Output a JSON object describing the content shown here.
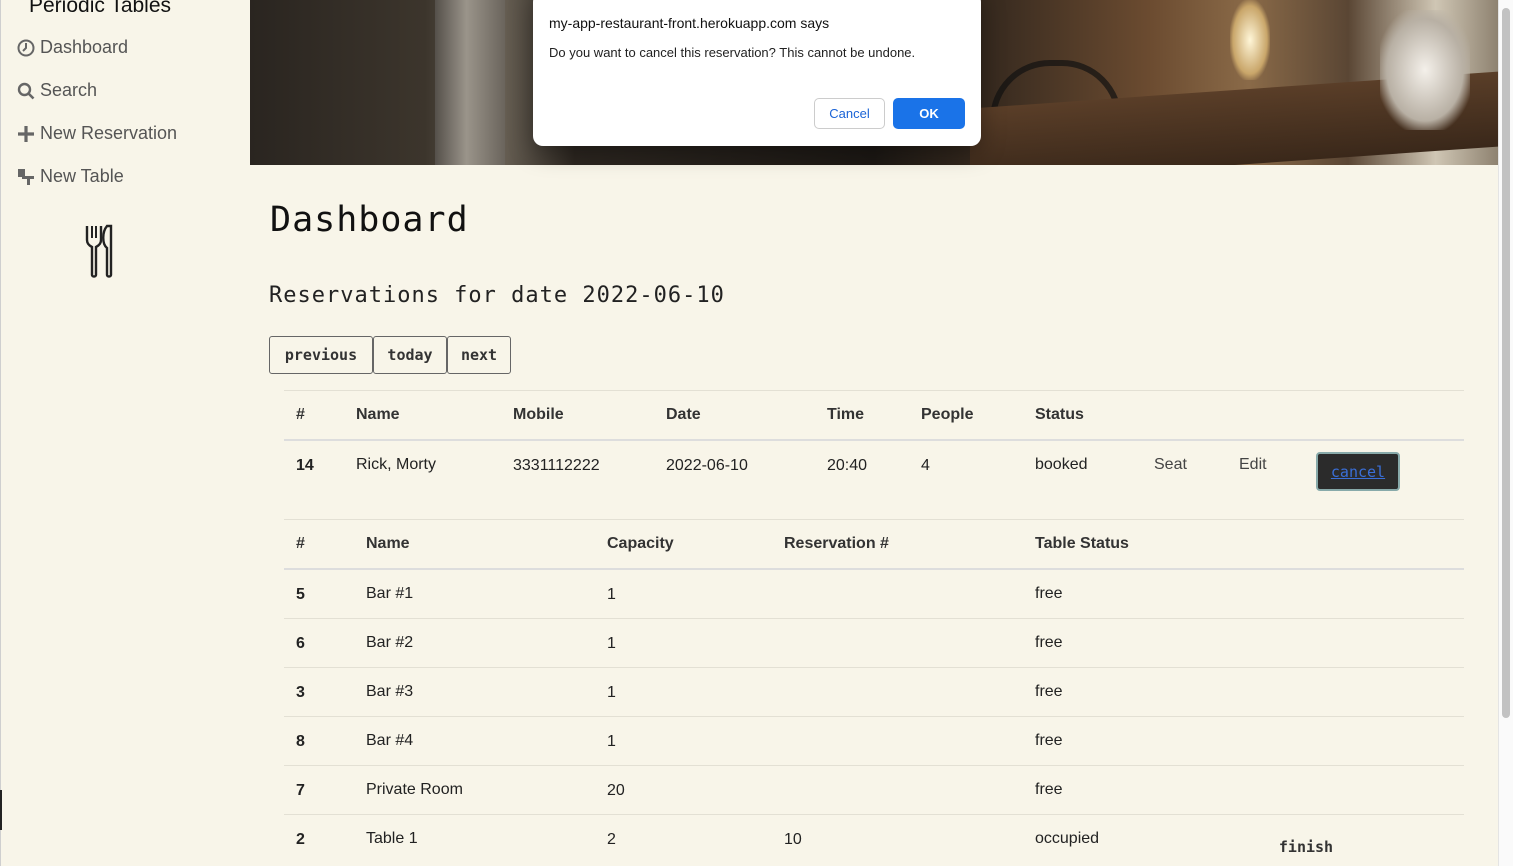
{
  "sidebar": {
    "brand": "Periodic Tables",
    "items": [
      {
        "label": "Dashboard",
        "icon": "dashboard-icon"
      },
      {
        "label": "Search",
        "icon": "search-icon"
      },
      {
        "label": "New Reservation",
        "icon": "plus-icon"
      },
      {
        "label": "New Table",
        "icon": "table-icon"
      }
    ],
    "logo_icon": "cutlery-icon"
  },
  "main": {
    "title": "Dashboard",
    "subtitle": "Reservations for date 2022-06-10",
    "buttons": {
      "previous": "previous",
      "today": "today",
      "next": "next"
    }
  },
  "reservations": {
    "headers": [
      "#",
      "Name",
      "Mobile",
      "Date",
      "Time",
      "People",
      "Status"
    ],
    "rows": [
      {
        "id": "14",
        "name": "Rick, Morty",
        "mobile": "3331112222",
        "date": "2022-06-10",
        "time": "20:40",
        "people": "4",
        "status": "booked",
        "seat": "Seat",
        "edit": "Edit",
        "cancel": "cancel"
      }
    ]
  },
  "tables": {
    "headers": [
      "#",
      "Name",
      "Capacity",
      "Reservation #",
      "Table Status"
    ],
    "rows": [
      {
        "id": "5",
        "name": "Bar #1",
        "capacity": "1",
        "reservation": "",
        "status": "free"
      },
      {
        "id": "6",
        "name": "Bar #2",
        "capacity": "1",
        "reservation": "",
        "status": "free"
      },
      {
        "id": "3",
        "name": "Bar #3",
        "capacity": "1",
        "reservation": "",
        "status": "free"
      },
      {
        "id": "8",
        "name": "Bar #4",
        "capacity": "1",
        "reservation": "",
        "status": "free"
      },
      {
        "id": "7",
        "name": "Private Room",
        "capacity": "20",
        "reservation": "",
        "status": "free"
      },
      {
        "id": "2",
        "name": "Table 1",
        "capacity": "2",
        "reservation": "10",
        "status": "occupied",
        "action": "finish"
      }
    ]
  },
  "dialog": {
    "origin": "my-app-restaurant-front.herokuapp.com says",
    "message": "Do you want to cancel this reservation? This cannot be undone.",
    "cancel_label": "Cancel",
    "ok_label": "OK"
  },
  "colors": {
    "background": "#f8f5e9",
    "ok_button": "#1a73e8",
    "cancel_button_bg": "#2b2b2b"
  }
}
